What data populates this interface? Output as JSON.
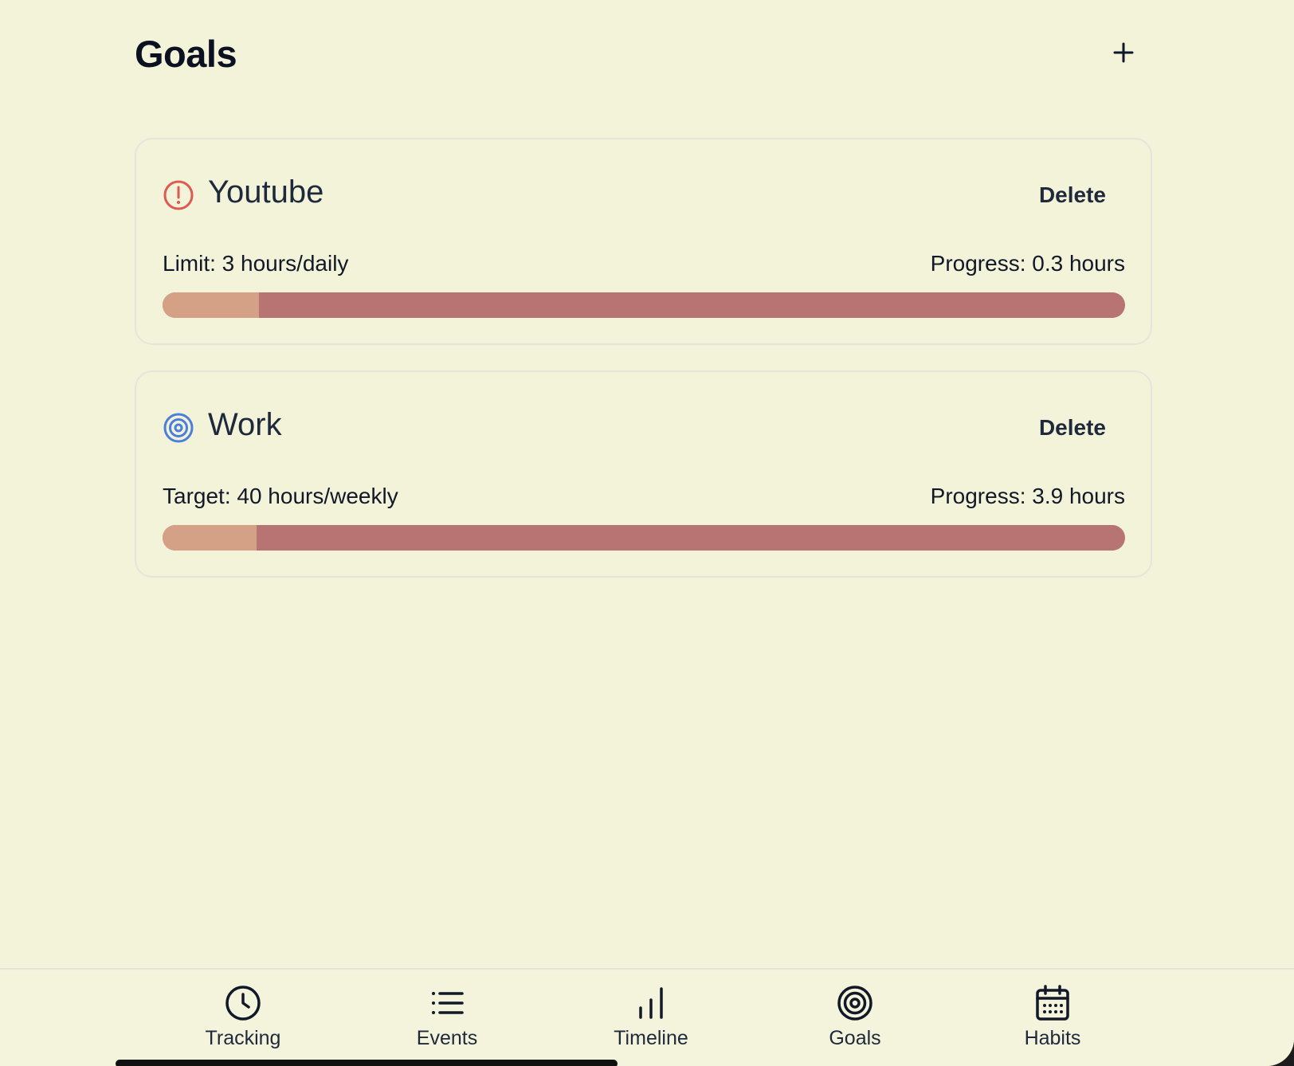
{
  "header": {
    "title": "Goals",
    "add_icon": "plus-icon"
  },
  "goals": [
    {
      "icon": "alert-circle-icon",
      "icon_color": "#dc5a50",
      "name": "Youtube",
      "delete_label": "Delete",
      "meta_left": "Limit: 3 hours/daily",
      "meta_right": "Progress: 0.3 hours",
      "progress_fraction": 0.1
    },
    {
      "icon": "target-icon",
      "icon_color": "#4a7fdc",
      "name": "Work",
      "delete_label": "Delete",
      "meta_left": "Target: 40 hours/weekly",
      "meta_right": "Progress: 3.9 hours",
      "progress_fraction": 0.0975
    }
  ],
  "colors": {
    "background": "#f3f3da",
    "bar_track": "#b87373",
    "bar_fill": "#d4a086"
  },
  "nav": {
    "items": [
      {
        "label": "Tracking",
        "icon": "clock-icon"
      },
      {
        "label": "Events",
        "icon": "list-icon"
      },
      {
        "label": "Timeline",
        "icon": "bar-chart-icon"
      },
      {
        "label": "Goals",
        "icon": "target-icon",
        "active": true
      },
      {
        "label": "Habits",
        "icon": "calendar-icon"
      }
    ]
  }
}
